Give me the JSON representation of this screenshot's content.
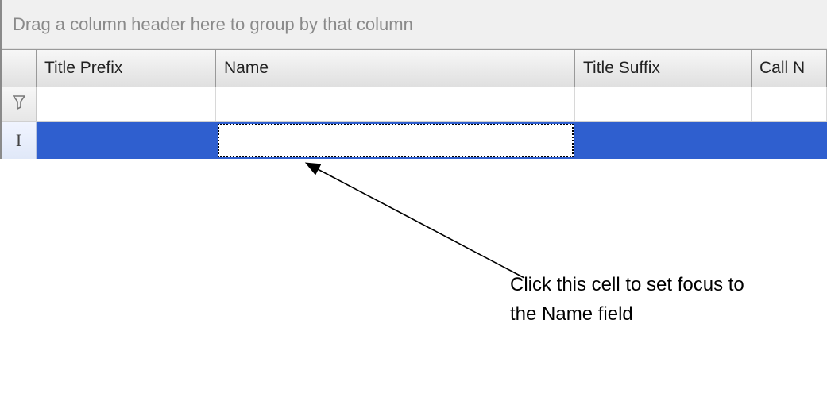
{
  "groupPanel": {
    "hint": "Drag a column header here to group by that column"
  },
  "columns": {
    "c0": "Title Prefix",
    "c1": "Name",
    "c2": "Title Suffix",
    "c3": "Call N"
  },
  "editRow": {
    "nameValue": ""
  },
  "annotation": {
    "line1": "Click this cell to set focus to",
    "line2": "the Name field"
  }
}
